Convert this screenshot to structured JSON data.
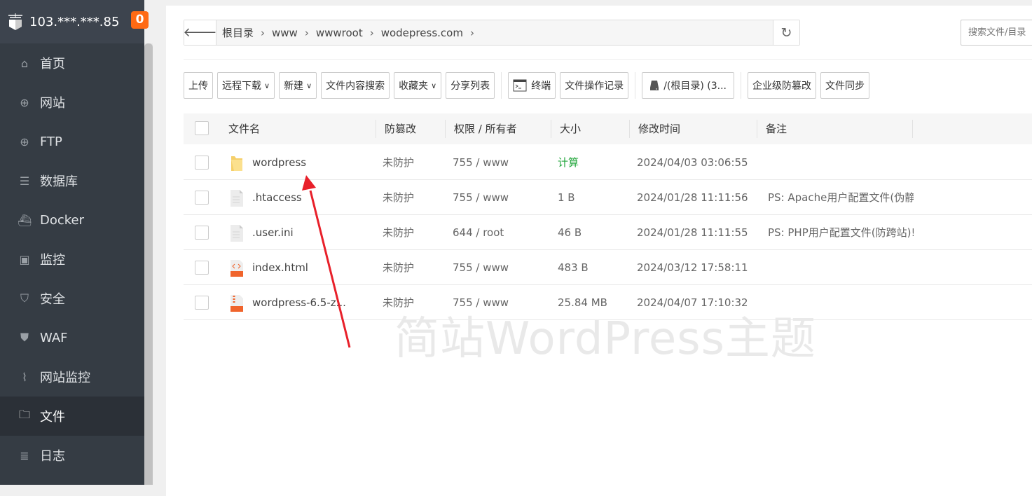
{
  "sidebar": {
    "server_ip": "103.***.***.85",
    "notification_count": "0",
    "items": [
      {
        "label": "首页",
        "icon": "home-icon"
      },
      {
        "label": "网站",
        "icon": "globe-icon"
      },
      {
        "label": "FTP",
        "icon": "globe-icon"
      },
      {
        "label": "数据库",
        "icon": "database-icon"
      },
      {
        "label": "Docker",
        "icon": "docker-icon"
      },
      {
        "label": "监控",
        "icon": "monitor-icon"
      },
      {
        "label": "安全",
        "icon": "shield-icon"
      },
      {
        "label": "WAF",
        "icon": "waf-icon"
      },
      {
        "label": "网站监控",
        "icon": "chart-icon"
      },
      {
        "label": "文件",
        "icon": "folder-icon",
        "active": true
      },
      {
        "label": "日志",
        "icon": "log-icon"
      }
    ]
  },
  "breadcrumb": [
    "根目录",
    "www",
    "wwwroot",
    "wodepress.com"
  ],
  "search": {
    "placeholder": "搜索文件/目录"
  },
  "toolbar": {
    "upload": "上传",
    "remote_download": "远程下载",
    "new": "新建",
    "content_search": "文件内容搜索",
    "favorites": "收藏夹",
    "share_list": "分享列表",
    "terminal": "终端",
    "op_log": "文件操作记录",
    "disk": "/(根目录) (3...",
    "tamper": "企业级防篡改",
    "sync": "文件同步"
  },
  "table": {
    "headers": [
      "文件名",
      "防篡改",
      "权限 / 所有者",
      "大小",
      "修改时间",
      "备注"
    ],
    "rows": [
      {
        "name": "wordpress",
        "type": "folder",
        "tamper": "未防护",
        "perm": "755 / www",
        "size": "计算",
        "mtime": "2024/04/03 03:06:55",
        "note": ""
      },
      {
        "name": ".htaccess",
        "type": "text",
        "tamper": "未防护",
        "perm": "755 / www",
        "size": "1 B",
        "mtime": "2024/01/28 11:11:56",
        "note": "PS: Apache用户配置文件(伪静"
      },
      {
        "name": ".user.ini",
        "type": "text",
        "tamper": "未防护",
        "perm": "644 / root",
        "size": "46 B",
        "mtime": "2024/01/28 11:11:55",
        "note": "PS: PHP用户配置文件(防跨站)!"
      },
      {
        "name": "index.html",
        "type": "html",
        "tamper": "未防护",
        "perm": "755 / www",
        "size": "483 B",
        "mtime": "2024/03/12 17:58:11",
        "note": ""
      },
      {
        "name": "wordpress-6.5-z...",
        "type": "zip",
        "tamper": "未防护",
        "perm": "755 / www",
        "size": "25.84 MB",
        "mtime": "2024/04/07 17:10:32",
        "note": ""
      }
    ]
  },
  "watermark": "简站WordPress主题",
  "colors": {
    "sidebar": "#353c44",
    "badge": "#ff6a14",
    "calc_link": "#20a53a",
    "arrow": "#e8202a"
  }
}
